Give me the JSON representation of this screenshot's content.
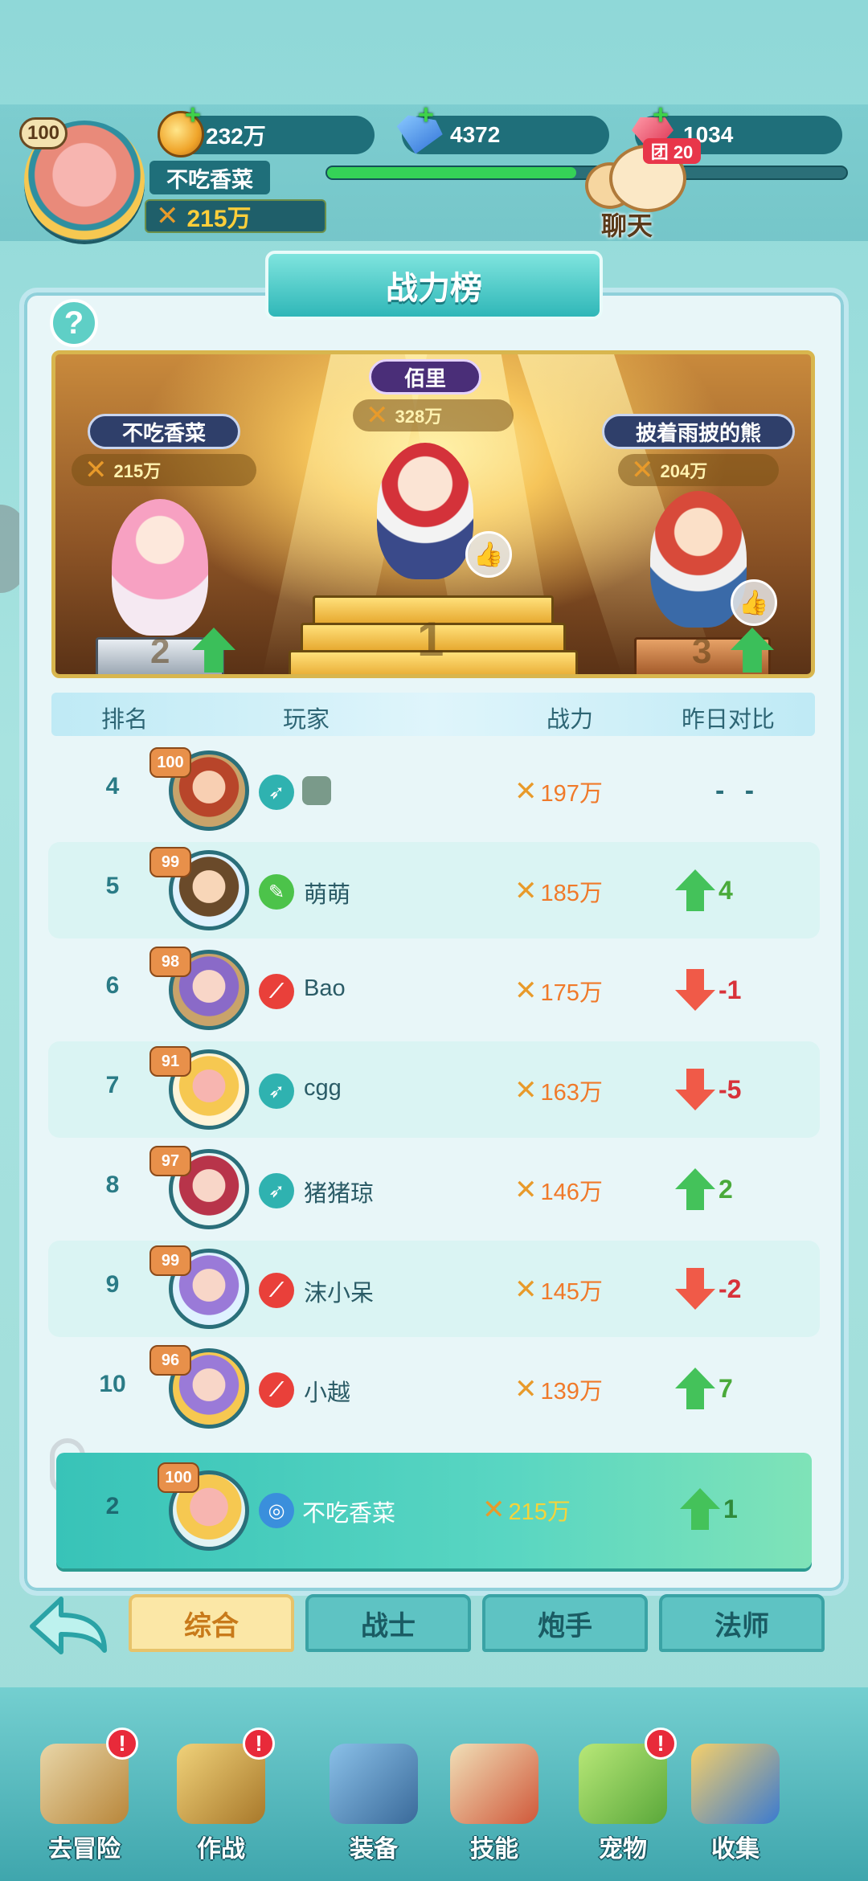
{
  "hud": {
    "level": "100",
    "gold": "232万",
    "gems": "4372",
    "rubies": "1034",
    "player_name": "不吃香菜",
    "combat_power": "215万",
    "exp_progress": 0.48,
    "chat_label": "聊天",
    "team_badge": "团 20"
  },
  "title": "战力榜",
  "help_label": "?",
  "podium": {
    "first": {
      "name": "佰里",
      "power": "328万",
      "number": "1"
    },
    "second": {
      "name": "不吃香菜",
      "power": "215万",
      "number": "2"
    },
    "third": {
      "name": "披着雨披的熊",
      "power": "204万",
      "number": "3"
    }
  },
  "columns": {
    "rank": "排名",
    "player": "玩家",
    "power": "战力",
    "compare": "昨日对比"
  },
  "rows": [
    {
      "rank": "4",
      "level": "100",
      "class": "bow",
      "name": "",
      "power": "197万",
      "trend": "none",
      "trend_text": "- -"
    },
    {
      "rank": "5",
      "level": "99",
      "class": "gun",
      "name": "萌萌",
      "power": "185万",
      "trend": "up",
      "trend_text": "4"
    },
    {
      "rank": "6",
      "level": "98",
      "class": "staff",
      "name": "Bao",
      "power": "175万",
      "trend": "down",
      "trend_text": "-1"
    },
    {
      "rank": "7",
      "level": "91",
      "class": "bow",
      "name": "cgg",
      "power": "163万",
      "trend": "down",
      "trend_text": "-5"
    },
    {
      "rank": "8",
      "level": "97",
      "class": "bow",
      "name": "猪猪琼",
      "power": "146万",
      "trend": "up",
      "trend_text": "2"
    },
    {
      "rank": "9",
      "level": "99",
      "class": "staff",
      "name": "沫小呆",
      "power": "145万",
      "trend": "down",
      "trend_text": "-2"
    },
    {
      "rank": "10",
      "level": "96",
      "class": "staff",
      "name": "小越",
      "power": "139万",
      "trend": "up",
      "trend_text": "7"
    }
  ],
  "self": {
    "rank": "2",
    "level": "100",
    "name": "不吃香菜",
    "power": "215万",
    "trend_text": "1"
  },
  "tabs": [
    {
      "label": "综合",
      "active": true
    },
    {
      "label": "战士",
      "active": false
    },
    {
      "label": "炮手",
      "active": false
    },
    {
      "label": "法师",
      "active": false
    }
  ],
  "nav": [
    {
      "label": "去冒险",
      "alert": "!"
    },
    {
      "label": "作战",
      "alert": "!"
    },
    {
      "label": "装备",
      "alert": ""
    },
    {
      "label": "技能",
      "alert": ""
    },
    {
      "label": "宠物",
      "alert": "!"
    },
    {
      "label": "收集",
      "alert": ""
    }
  ],
  "colors": {
    "accent": "#2fb7b8",
    "up": "#44c25a",
    "down": "#f05a48",
    "power": "#f07a2a"
  }
}
